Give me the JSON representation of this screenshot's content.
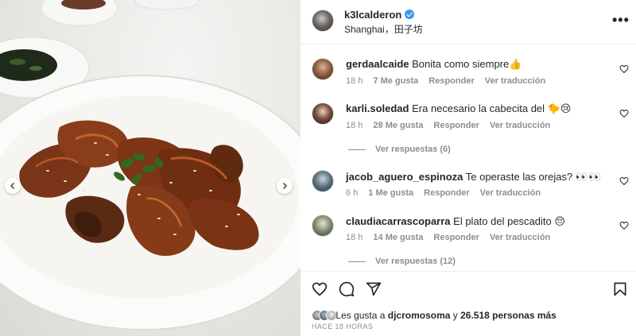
{
  "post": {
    "username": "k3lcalderon",
    "location": "Shanghai，田子坊",
    "more_label": "•••"
  },
  "comments": [
    {
      "username": "gerdaalcaide",
      "text": "Bonita como siempre👍",
      "time": "18 h",
      "likes": "7 Me gusta",
      "reply": "Responder",
      "translate": "Ver traducción",
      "replies": ""
    },
    {
      "username": "karli.soledad",
      "text": "Era necesario la cabecita del 🐤😢",
      "time": "18 h",
      "likes": "28 Me gusta",
      "reply": "Responder",
      "translate": "Ver traducción",
      "replies": "Ver respuestas (6)"
    },
    {
      "username": "jacob_aguero_espinoza",
      "text": "Te operaste las orejas? 👀👀",
      "time": "6 h",
      "likes": "1 Me gusta",
      "reply": "Responder",
      "translate": "Ver traducción",
      "replies": ""
    },
    {
      "username": "claudiacarrascoparra",
      "text": "El plato del pescadito 😔",
      "time": "18 h",
      "likes": "14 Me gusta",
      "reply": "Responder",
      "translate": "Ver traducción",
      "replies": "Ver respuestas (12)"
    }
  ],
  "likes_line": {
    "prefix": "Les gusta a",
    "first_user": "djcromosoma",
    "connector": "y",
    "count": "26.518 personas más"
  },
  "timestamp": "HACE 18 HORAS",
  "colors": {
    "verified": "#3897f0",
    "muted": "#8e8e8e",
    "text": "#262626"
  },
  "icons": {
    "like": "heart-icon",
    "comment": "comment-bubble-icon",
    "share": "paper-plane-icon",
    "save": "bookmark-icon"
  }
}
